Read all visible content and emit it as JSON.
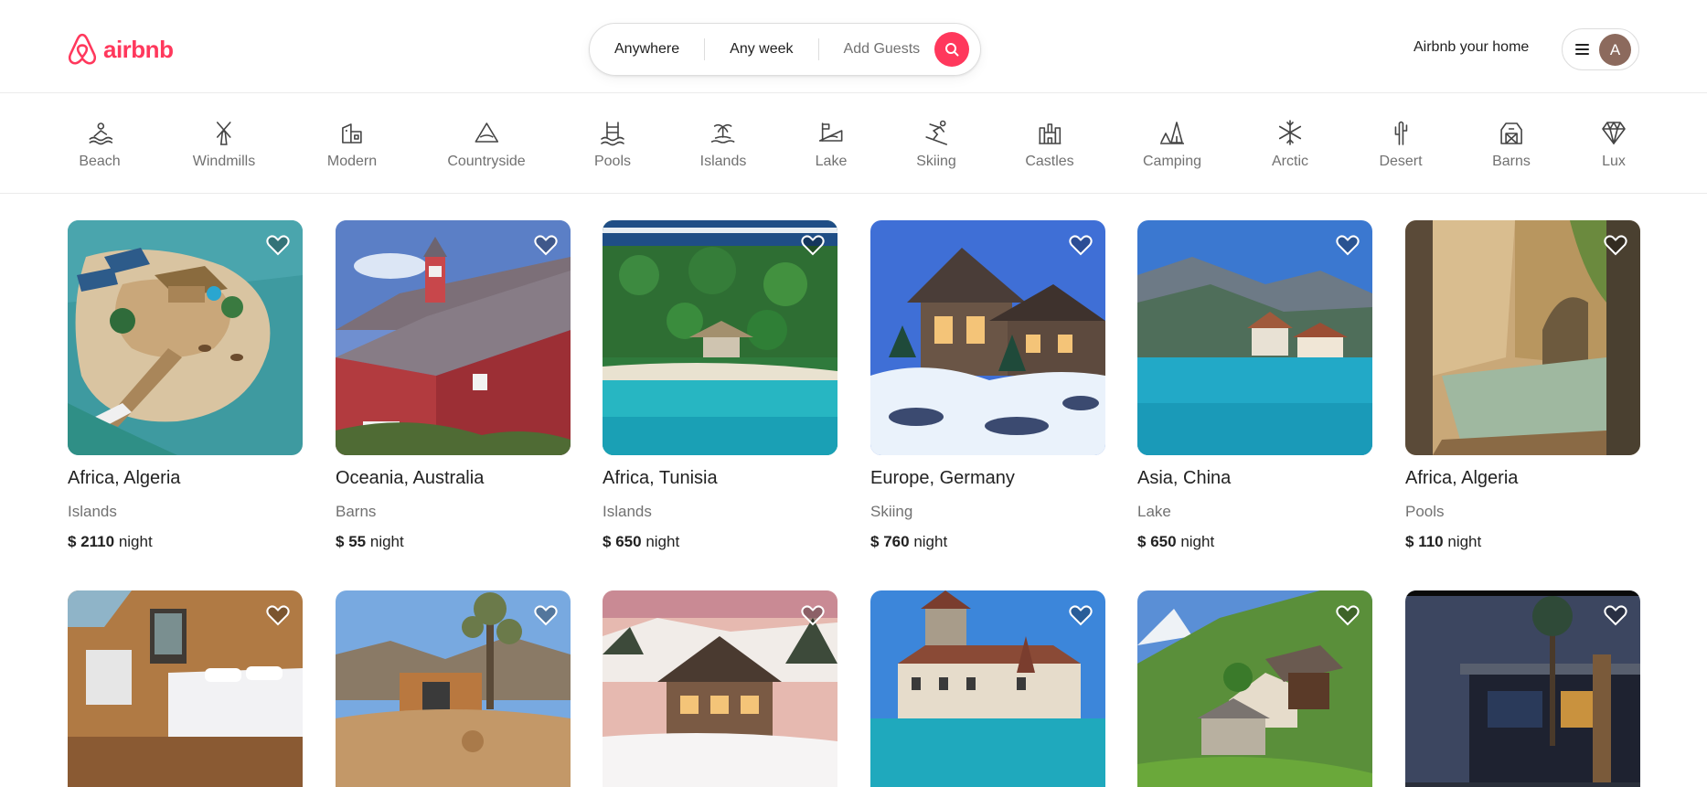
{
  "brand": {
    "name": "airbnb",
    "accent": "#ff385c"
  },
  "search": {
    "where": "Anywhere",
    "when": "Any week",
    "guests": "Add Guests"
  },
  "header": {
    "host_link": "Airbnb your home",
    "avatar_initial": "A"
  },
  "categories": [
    {
      "label": "Beach",
      "icon": "beach-icon"
    },
    {
      "label": "Windmills",
      "icon": "windmill-icon"
    },
    {
      "label": "Modern",
      "icon": "modern-icon"
    },
    {
      "label": "Countryside",
      "icon": "countryside-icon"
    },
    {
      "label": "Pools",
      "icon": "pool-icon"
    },
    {
      "label": "Islands",
      "icon": "island-icon"
    },
    {
      "label": "Lake",
      "icon": "lake-icon"
    },
    {
      "label": "Skiing",
      "icon": "skiing-icon"
    },
    {
      "label": "Castles",
      "icon": "castle-icon"
    },
    {
      "label": "Camping",
      "icon": "camping-icon"
    },
    {
      "label": "Arctic",
      "icon": "snowflake-icon"
    },
    {
      "label": "Desert",
      "icon": "cactus-icon"
    },
    {
      "label": "Barns",
      "icon": "barn-icon"
    },
    {
      "label": "Lux",
      "icon": "diamond-icon"
    }
  ],
  "listings": [
    {
      "location": "Africa, Algeria",
      "category": "Islands",
      "currency": "$",
      "price": "2110",
      "unit": "night",
      "photo": "island-resort-photo"
    },
    {
      "location": "Oceania, Australia",
      "category": "Barns",
      "currency": "$",
      "price": "55",
      "unit": "night",
      "photo": "red-barn-photo"
    },
    {
      "location": "Africa, Tunisia",
      "category": "Islands",
      "currency": "$",
      "price": "650",
      "unit": "night",
      "photo": "tropical-island-photo"
    },
    {
      "location": "Europe, Germany",
      "category": "Skiing",
      "currency": "$",
      "price": "760",
      "unit": "night",
      "photo": "snowy-chalet-photo"
    },
    {
      "location": "Asia, China",
      "category": "Lake",
      "currency": "$",
      "price": "650",
      "unit": "night",
      "photo": "lake-village-photo"
    },
    {
      "location": "Africa, Algeria",
      "category": "Pools",
      "currency": "$",
      "price": "110",
      "unit": "night",
      "photo": "stone-pool-photo"
    },
    {
      "photo": "cabin-bedroom-photo"
    },
    {
      "photo": "desert-house-photo"
    },
    {
      "photo": "mountain-lodge-photo"
    },
    {
      "photo": "lakeside-castle-photo"
    },
    {
      "photo": "alpine-cottage-photo"
    },
    {
      "photo": "modern-villa-photo"
    }
  ]
}
